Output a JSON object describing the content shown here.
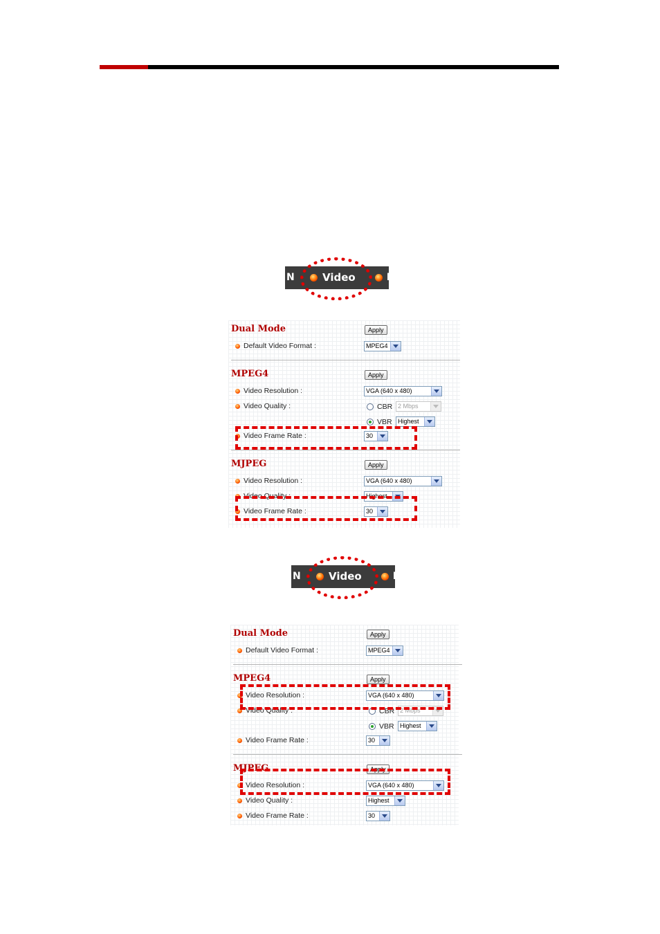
{
  "nav": {
    "video_label": "Video",
    "left_fragment": "N",
    "right_fragment": "I"
  },
  "panels": [
    {
      "dual_mode": {
        "title": "Dual Mode",
        "apply_label": "Apply",
        "default_format_label": "Default Video Format :",
        "default_format_value": "MPEG4"
      },
      "mpeg4": {
        "title": "MPEG4",
        "apply_label": "Apply",
        "resolution_label": "Video Resolution :",
        "resolution_value": "VGA (640 x 480)",
        "quality_label": "Video Quality :",
        "cbr_label": "CBR",
        "cbr_value": "2 Mbps",
        "vbr_label": "VBR",
        "vbr_value": "Highest",
        "frame_rate_label": "Video Frame Rate :",
        "frame_rate_value": "30"
      },
      "mjpeg": {
        "title": "MJPEG",
        "apply_label": "Apply",
        "resolution_label": "Video Resolution :",
        "resolution_value": "VGA (640 x 480)",
        "quality_label": "Video Quality :",
        "quality_value": "Highest",
        "frame_rate_label": "Video Frame Rate :",
        "frame_rate_value": "30"
      }
    },
    {
      "dual_mode": {
        "title": "Dual Mode",
        "apply_label": "Apply",
        "default_format_label": "Default Video Format :",
        "default_format_value": "MPEG4"
      },
      "mpeg4": {
        "title": "MPEG4",
        "apply_label": "Apply",
        "resolution_label": "Video Resolution :",
        "resolution_value": "VGA (640 x 480)",
        "quality_label": "Video Quality :",
        "cbr_label": "CBR",
        "cbr_value": "2 Mbps",
        "vbr_label": "VBR",
        "vbr_value": "Highest",
        "frame_rate_label": "Video Frame Rate :",
        "frame_rate_value": "30"
      },
      "mjpeg": {
        "title": "MJPEG",
        "apply_label": "Apply",
        "resolution_label": "Video Resolution :",
        "resolution_value": "VGA (640 x 480)",
        "quality_label": "Video Quality :",
        "quality_value": "Highest",
        "frame_rate_label": "Video Frame Rate :",
        "frame_rate_value": "30"
      }
    }
  ],
  "colors": {
    "accent_red": "#c00000",
    "highlight_red": "#e00000",
    "nav_bg": "#3c3c3c",
    "section_title": "#b00000"
  }
}
